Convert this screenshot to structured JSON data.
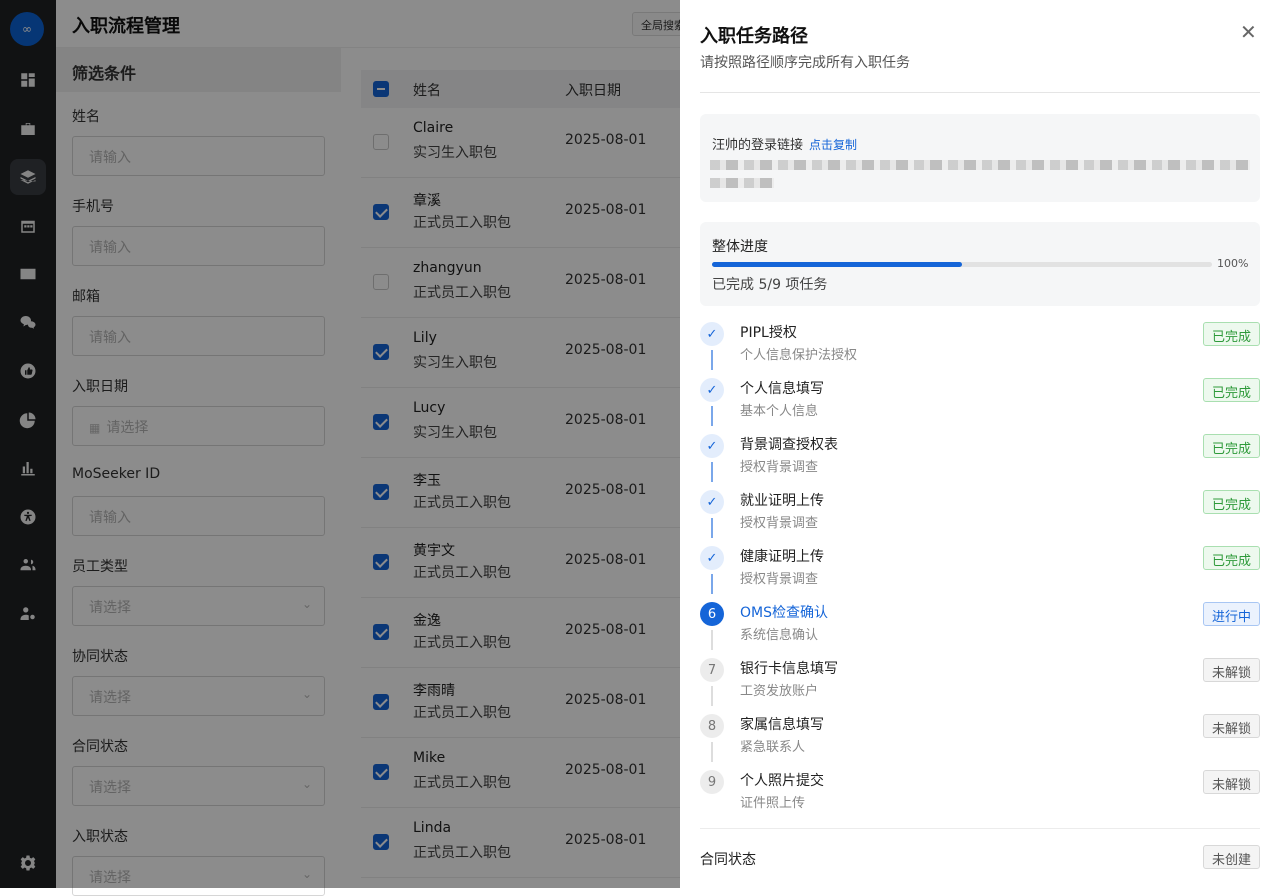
{
  "app": {
    "logo_text": "∞",
    "page_title": "入职流程管理",
    "global_search": "全局搜索"
  },
  "rail": {
    "icons": [
      "dashboard-icon",
      "briefcase-icon",
      "layers-icon",
      "calendar-icon",
      "id-card-icon",
      "wechat-icon",
      "thumbs-up-icon",
      "pie-chart-icon",
      "bar-chart-icon",
      "accessibility-icon",
      "users-icon",
      "user-settings-icon",
      "settings-icon"
    ],
    "active_index": 2
  },
  "filter": {
    "title": "筛选条件",
    "fields": [
      {
        "label": "姓名",
        "placeholder": "请输入",
        "type": "input"
      },
      {
        "label": "手机号",
        "placeholder": "请输入",
        "type": "input"
      },
      {
        "label": "邮箱",
        "placeholder": "请输入",
        "type": "input"
      },
      {
        "label": "入职日期",
        "placeholder": "请选择",
        "type": "date"
      },
      {
        "label": "MoSeeker ID",
        "placeholder": "请输入",
        "type": "input"
      },
      {
        "label": "员工类型",
        "placeholder": "请选择",
        "type": "select"
      },
      {
        "label": "协同状态",
        "placeholder": "请选择",
        "type": "select"
      },
      {
        "label": "合同状态",
        "placeholder": "请选择",
        "type": "select"
      },
      {
        "label": "入职状态",
        "placeholder": "请选择",
        "type": "select"
      }
    ]
  },
  "table": {
    "headers": {
      "name": "姓名",
      "date": "入职日期"
    },
    "rows": [
      {
        "name": "Claire",
        "package": "实习生入职包",
        "date": "2025-08-01",
        "checked": false
      },
      {
        "name": "章溪",
        "package": "正式员工入职包",
        "date": "2025-08-01",
        "checked": true
      },
      {
        "name": "zhangyun",
        "package": "正式员工入职包",
        "date": "2025-08-01",
        "checked": false
      },
      {
        "name": "Lily",
        "package": "实习生入职包",
        "date": "2025-08-01",
        "checked": true
      },
      {
        "name": "Lucy",
        "package": "实习生入职包",
        "date": "2025-08-01",
        "checked": true
      },
      {
        "name": "李玉",
        "package": "正式员工入职包",
        "date": "2025-08-01",
        "checked": true
      },
      {
        "name": "黄宇文",
        "package": "正式员工入职包",
        "date": "2025-08-01",
        "checked": true
      },
      {
        "name": "金逸",
        "package": "正式员工入职包",
        "date": "2025-08-01",
        "checked": true
      },
      {
        "name": "李雨晴",
        "package": "正式员工入职包",
        "date": "2025-08-01",
        "checked": true
      },
      {
        "name": "Mike",
        "package": "正式员工入职包",
        "date": "2025-08-01",
        "checked": true
      },
      {
        "name": "Linda",
        "package": "正式员工入职包",
        "date": "2025-08-01",
        "checked": true
      }
    ]
  },
  "drawer": {
    "title": "入职任务路径",
    "subtitle": "请按照路径顺序完成所有入职任务",
    "login_link_label": "汪帅的登录链接",
    "copy_label": "点击复制",
    "progress_title": "整体进度",
    "progress_fraction": 0.5,
    "progress_pct_label": "100%",
    "progress_note": "已完成 5/9 项任务",
    "steps": [
      {
        "num": "✓",
        "title": "PIPL授权",
        "sub": "个人信息保护法授权",
        "status": "已完成",
        "state": "done"
      },
      {
        "num": "✓",
        "title": "个人信息填写",
        "sub": "基本个人信息",
        "status": "已完成",
        "state": "done"
      },
      {
        "num": "✓",
        "title": "背景调查授权表",
        "sub": "授权背景调查",
        "status": "已完成",
        "state": "done"
      },
      {
        "num": "✓",
        "title": "就业证明上传",
        "sub": "授权背景调查",
        "status": "已完成",
        "state": "done"
      },
      {
        "num": "✓",
        "title": "健康证明上传",
        "sub": "授权背景调查",
        "status": "已完成",
        "state": "done"
      },
      {
        "num": "6",
        "title": "OMS检查确认",
        "sub": "系统信息确认",
        "status": "进行中",
        "state": "cur"
      },
      {
        "num": "7",
        "title": "银行卡信息填写",
        "sub": "工资发放账户",
        "status": "未解锁",
        "state": "lock"
      },
      {
        "num": "8",
        "title": "家属信息填写",
        "sub": "紧急联系人",
        "status": "未解锁",
        "state": "lock"
      },
      {
        "num": "9",
        "title": "个人照片提交",
        "sub": "证件照上传",
        "status": "未解锁",
        "state": "lock"
      }
    ],
    "contract_label": "合同状态",
    "contract_status": "未创建"
  }
}
